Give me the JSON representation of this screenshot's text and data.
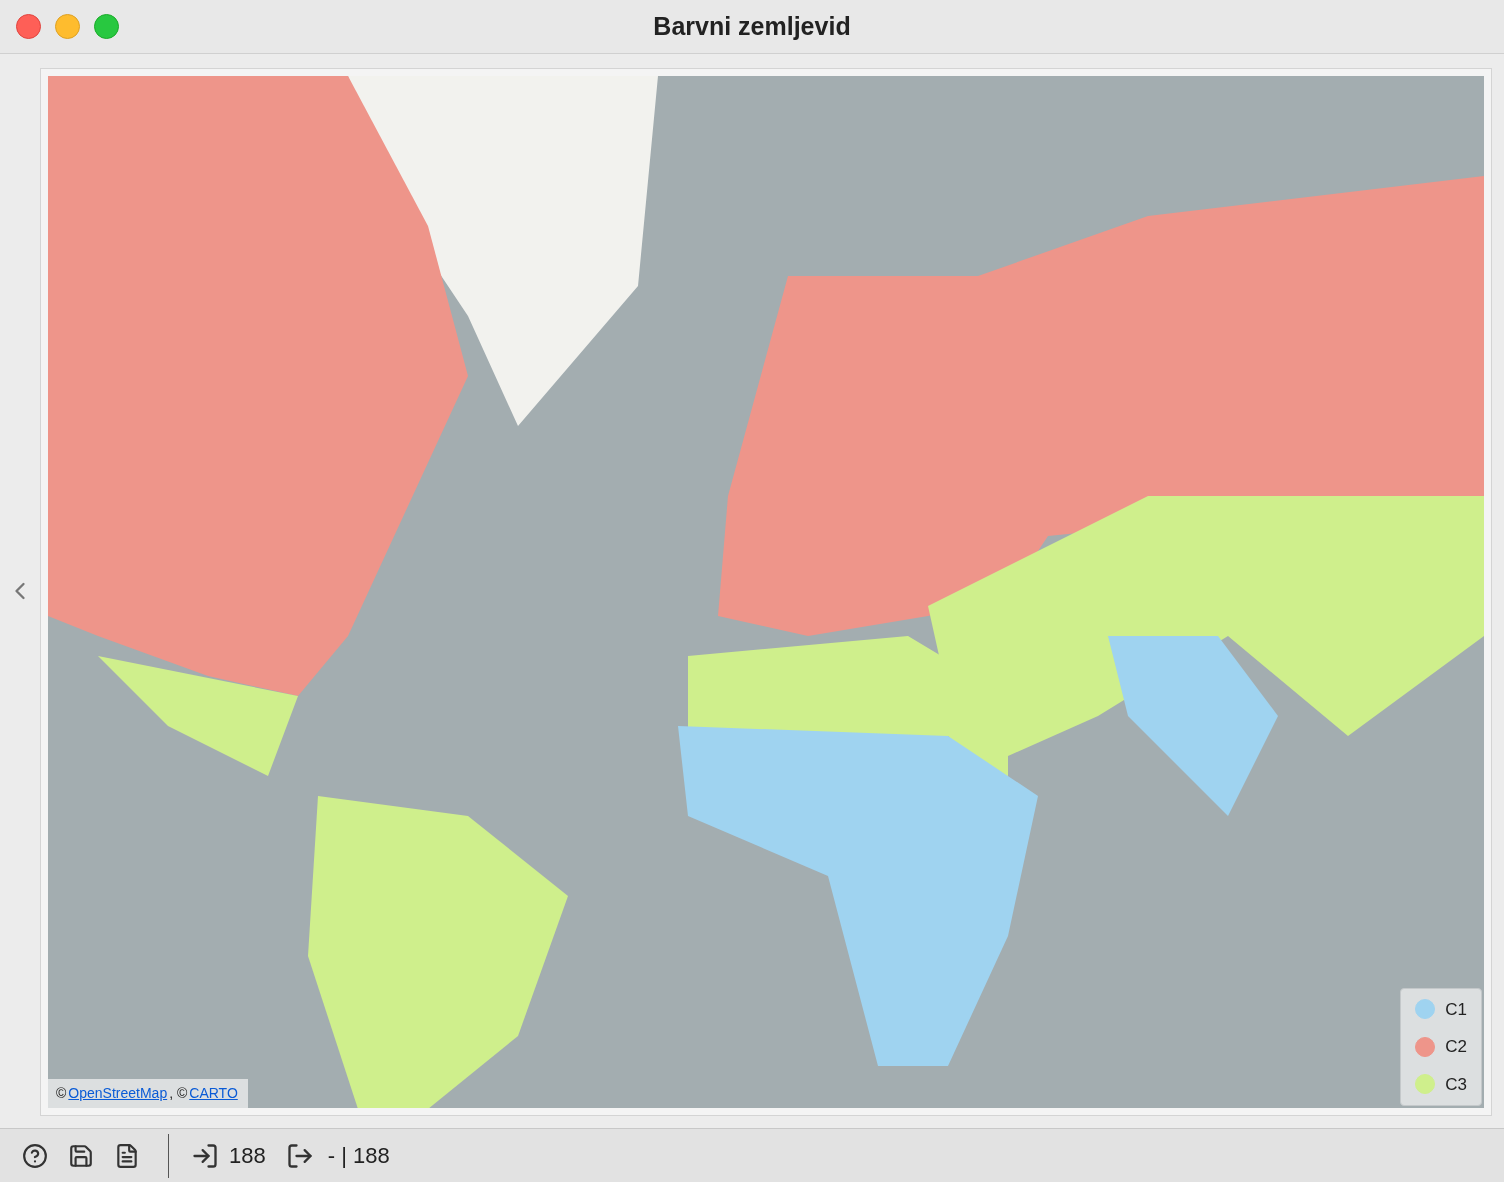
{
  "window": {
    "title": "Barvni zemljevid"
  },
  "map": {
    "attribution": [
      {
        "kind": "text",
        "text": "©"
      },
      {
        "kind": "link",
        "text": "OpenStreetMap"
      },
      {
        "kind": "text",
        "text": ", ©"
      },
      {
        "kind": "link",
        "text": "CARTO"
      }
    ],
    "legend": [
      {
        "label": "C1",
        "color": "#9fd3f0"
      },
      {
        "label": "C2",
        "color": "#ee958a"
      },
      {
        "label": "C3",
        "color": "#cfef8c"
      }
    ]
  },
  "status_bar": {
    "input_count": "188",
    "output_count": "- | 188"
  }
}
